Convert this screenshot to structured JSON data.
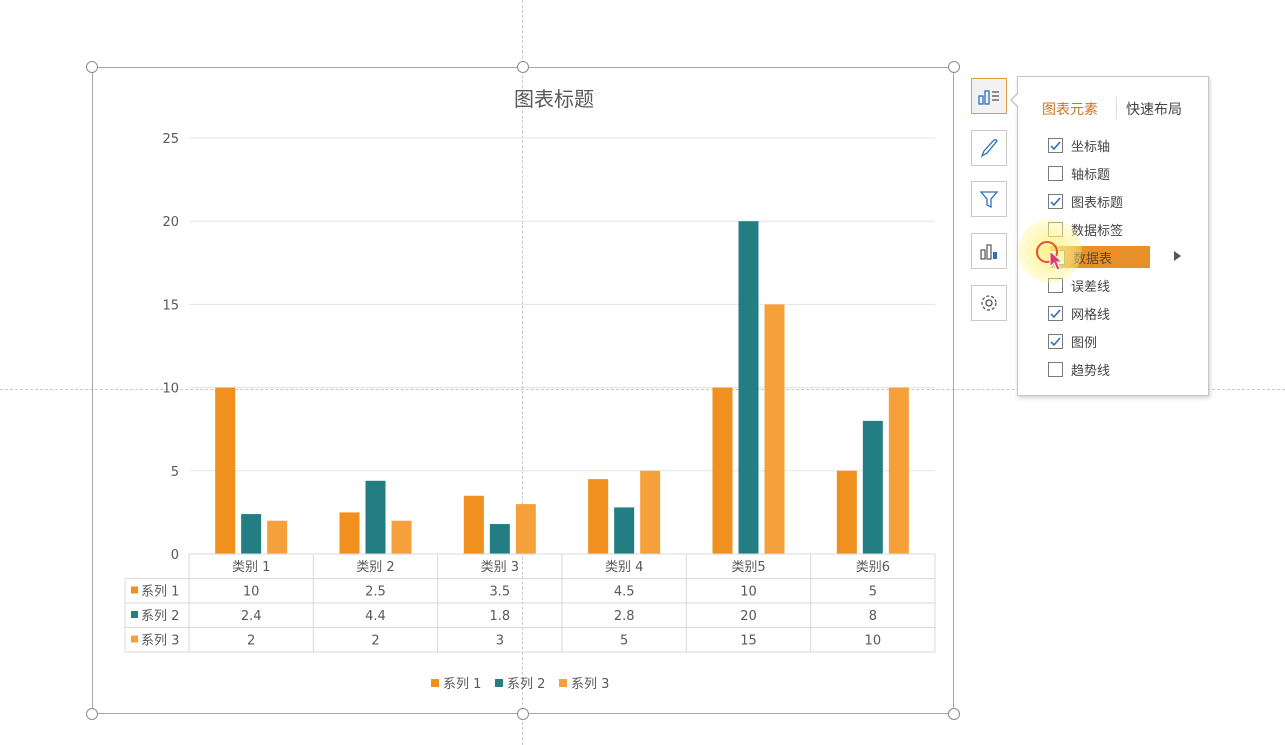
{
  "chart_data": {
    "type": "bar",
    "title": "图表标题",
    "categories": [
      "类别 1",
      "类别 2",
      "类别 3",
      "类别 4",
      "类别5",
      "类别6"
    ],
    "series": [
      {
        "name": "系列 1",
        "values": [
          10,
          2.5,
          3.5,
          4.5,
          10,
          5
        ],
        "color": "#f0901e"
      },
      {
        "name": "系列 2",
        "values": [
          2.4,
          4.4,
          1.8,
          2.8,
          20,
          8
        ],
        "color": "#237e83"
      },
      {
        "name": "系列 3",
        "values": [
          2,
          2,
          3,
          5,
          15,
          10
        ],
        "color": "#f6a03c"
      }
    ],
    "ylim": [
      0,
      25
    ],
    "yticks": [
      0,
      5,
      10,
      15,
      20,
      25
    ],
    "grid": true,
    "legend": "bottom",
    "data_table": true
  },
  "side_toolbar": {
    "buttons": [
      {
        "icon": "chart-elements-icon",
        "active": true
      },
      {
        "icon": "brush-icon"
      },
      {
        "icon": "filter-icon"
      },
      {
        "icon": "chart-style-icon"
      },
      {
        "icon": "gear-icon"
      }
    ]
  },
  "elements_panel": {
    "tabs": [
      "图表元素",
      "快速布局"
    ],
    "active_tab": "图表元素",
    "items": [
      {
        "label": "坐标轴",
        "checked": true
      },
      {
        "label": "轴标题",
        "checked": false
      },
      {
        "label": "图表标题",
        "checked": true
      },
      {
        "label": "数据标签",
        "checked": false
      },
      {
        "label": "数据表",
        "checked": false,
        "highlighted": true
      },
      {
        "label": "误差线",
        "checked": false
      },
      {
        "label": "网格线",
        "checked": true
      },
      {
        "label": "图例",
        "checked": true
      },
      {
        "label": "趋势线",
        "checked": false
      }
    ]
  },
  "colors": {
    "accent": "#d4711e",
    "highlight": "#e8912a",
    "checkmark": "#2e6fbf"
  }
}
